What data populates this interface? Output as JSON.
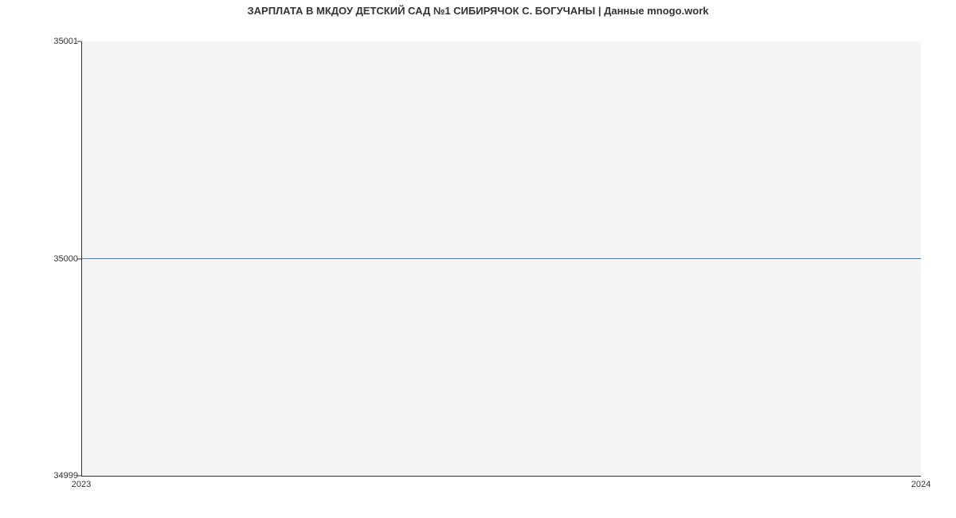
{
  "chart_data": {
    "type": "line",
    "title": "ЗАРПЛАТА В МКДОУ ДЕТСКИЙ САД №1 СИБИРЯЧОК С. БОГУЧАНЫ | Данные mnogo.work",
    "xlabel": "",
    "ylabel": "",
    "x": [
      2023,
      2024
    ],
    "values": [
      35000,
      35000
    ],
    "y_ticks": [
      34999,
      35000,
      35001
    ],
    "x_ticks": [
      2023,
      2024
    ],
    "ylim": [
      34999,
      35001
    ],
    "xlim": [
      2023,
      2024
    ],
    "line_color": "#3a7bd5",
    "plot_bg": "#f4f4f4"
  }
}
